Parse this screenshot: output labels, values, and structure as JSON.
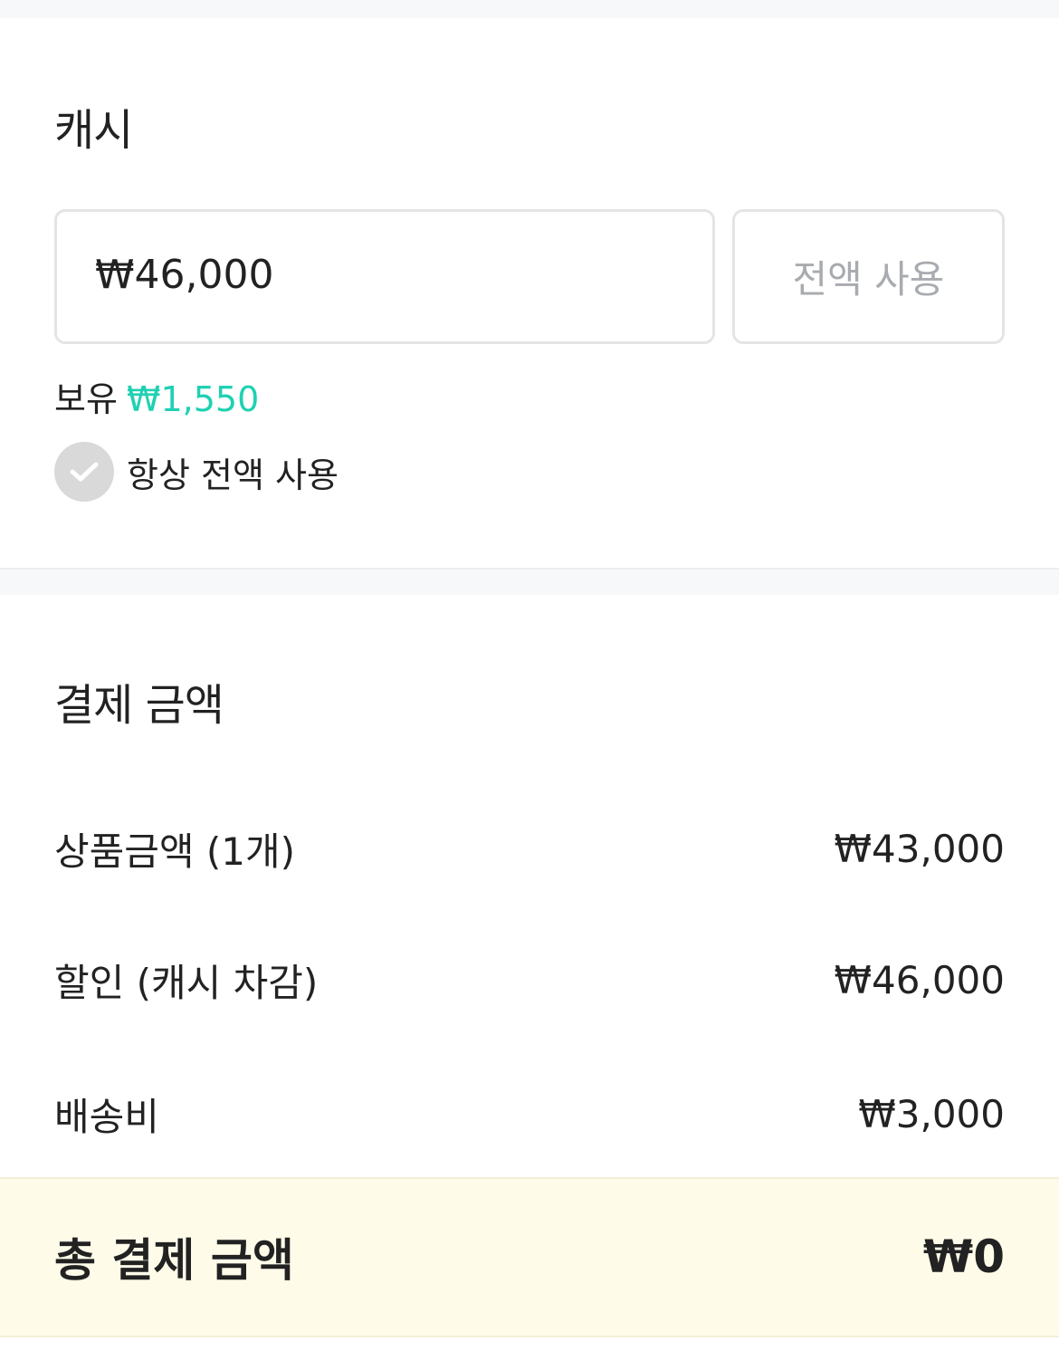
{
  "cash": {
    "title": "캐시",
    "input_value": "₩46,000",
    "use_all_label": "전액 사용",
    "owned_label": "보유",
    "owned_amount": "₩1,550",
    "always_use_all_label": "항상 전액 사용"
  },
  "payment": {
    "title": "결제 금액",
    "rows": [
      {
        "label": "상품금액 (1개)",
        "value": "₩43,000"
      },
      {
        "label": "할인 (캐시 차감)",
        "value": "₩46,000"
      },
      {
        "label": "배송비",
        "value": "₩3,000"
      }
    ],
    "total_label": "총 결제 금액",
    "total_value": "₩0"
  },
  "colors": {
    "accent": "#1fd1b2",
    "total_background": "#fefbe9",
    "muted_text": "#a8abb0"
  },
  "icons": {
    "check": "check-icon"
  }
}
